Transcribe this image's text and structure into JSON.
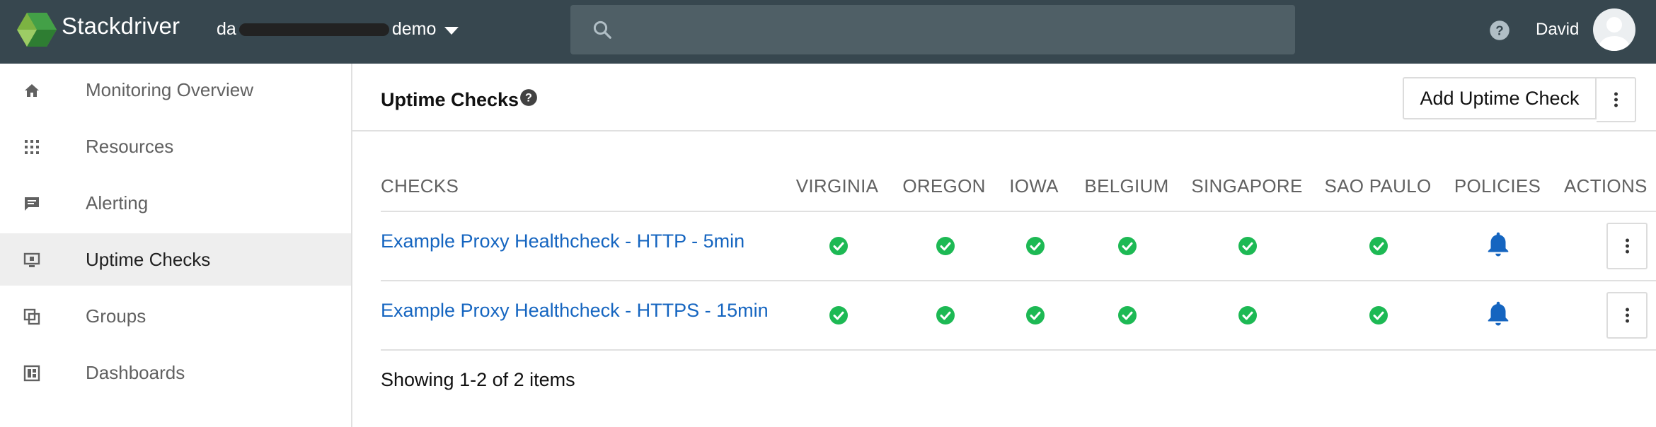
{
  "app": {
    "brand": "Stackdriver",
    "project_prefix": "da",
    "project_suffix": "demo",
    "user_name": "David",
    "search_placeholder": ""
  },
  "sidebar": {
    "items": [
      {
        "label": "Monitoring Overview",
        "icon": "home-icon"
      },
      {
        "label": "Resources",
        "icon": "grid-icon"
      },
      {
        "label": "Alerting",
        "icon": "alert-message-icon"
      },
      {
        "label": "Uptime Checks",
        "icon": "monitor-icon",
        "active": true
      },
      {
        "label": "Groups",
        "icon": "groups-icon"
      },
      {
        "label": "Dashboards",
        "icon": "dashboard-icon"
      }
    ]
  },
  "page": {
    "title": "Uptime Checks",
    "add_button": "Add Uptime Check"
  },
  "table": {
    "columns": [
      "CHECKS",
      "VIRGINIA",
      "OREGON",
      "IOWA",
      "BELGIUM",
      "SINGAPORE",
      "SAO PAULO",
      "POLICIES",
      "ACTIONS"
    ],
    "rows": [
      {
        "name": "Example Proxy Healthcheck - HTTP - 5min",
        "statuses": [
          "ok",
          "ok",
          "ok",
          "ok",
          "ok",
          "ok"
        ],
        "policy": "bell-icon"
      },
      {
        "name": "Example Proxy Healthcheck - HTTPS - 15min",
        "statuses": [
          "ok",
          "ok",
          "ok",
          "ok",
          "ok",
          "ok"
        ],
        "policy": "bell-icon"
      }
    ],
    "footer": "Showing 1-2 of 2 items"
  },
  "colors": {
    "topbar": "#37474f",
    "link": "#1565c0",
    "ok": "#1db954",
    "bell": "#1565c0"
  }
}
